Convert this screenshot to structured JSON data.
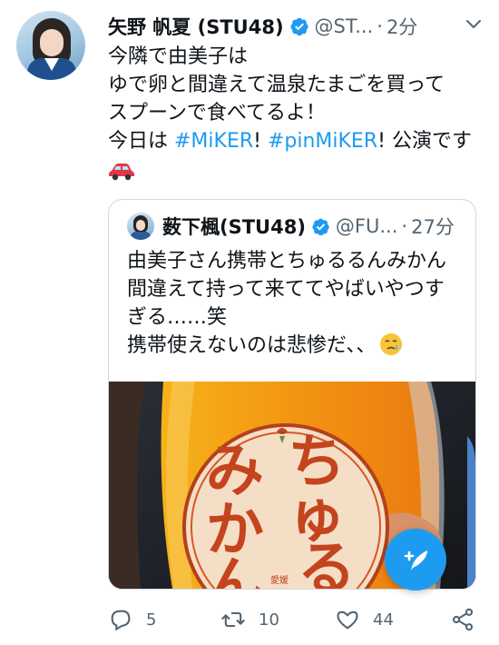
{
  "tweet": {
    "author_name": "矢野 帆夏 (STU48)",
    "handle": "@ST...",
    "separator": "·",
    "time": "2分",
    "lines": [
      "今隣で由美子は",
      "ゆで卵と間違えて温泉たまごを買って",
      "スプーンで食べてるよ！"
    ],
    "line4": {
      "prefix": "今日は ",
      "hashtag1": "#MiKER",
      "mid": "! ",
      "hashtag2": "#pinMiKER",
      "suffix": "! 公演です"
    },
    "car_icon": "car-emoji-icon"
  },
  "quoted": {
    "author_name": "薮下楓(STU48)",
    "handle": "@FU...",
    "separator": "·",
    "time": "27分",
    "lines": [
      "由美子さん携帯とちゅるるんみかん",
      "間違えて持って来ててやばいやつす",
      "ぎる……笑",
      "携帯使えないのは悲惨だ、、"
    ],
    "media": {
      "label_text": "みかんちゅるるん",
      "small_text": "愛媛"
    }
  },
  "actions": {
    "reply_count": "5",
    "retweet_count": "10",
    "like_count": "44"
  },
  "colors": {
    "accent": "#1d9bf0",
    "text": "#0f1419",
    "secondary": "#536471",
    "border": "#cfd9de"
  }
}
